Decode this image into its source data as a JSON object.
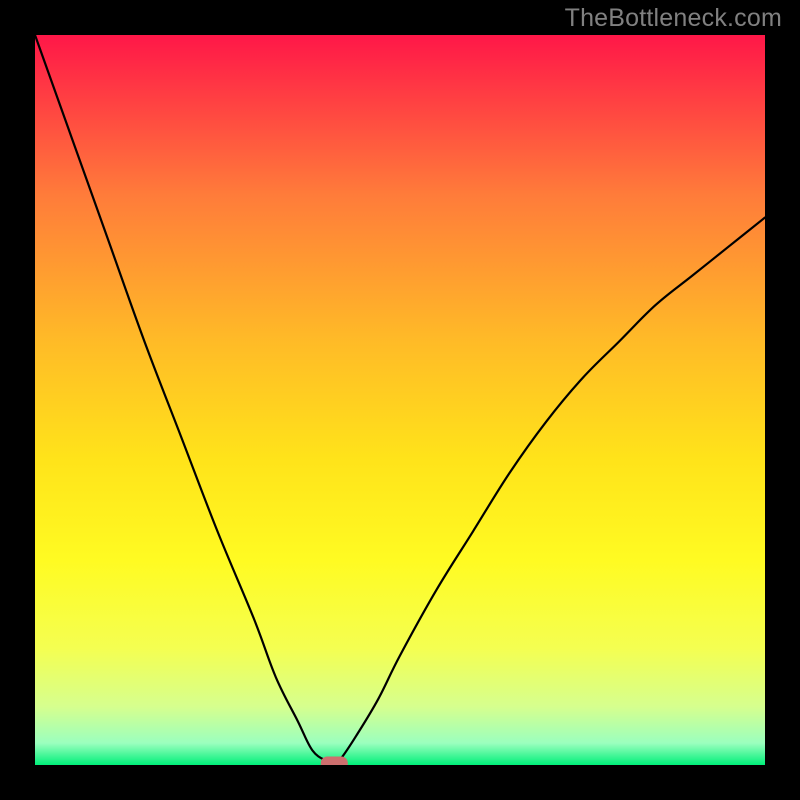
{
  "watermark": "TheBottleneck.com",
  "colors": {
    "frame": "#000000",
    "curve": "#000000",
    "marker_fill": "#cd6f6e",
    "marker_stroke": "#cd6f6e",
    "gradient": {
      "top": "#ff1748",
      "g2": "#ff7c3a",
      "g3": "#ffbb27",
      "g4": "#ffe31a",
      "g5": "#fffb22",
      "g6": "#f4ff51",
      "g7": "#d6ff8e",
      "g8": "#9bffbe",
      "bottom": "#00ef79"
    }
  },
  "chart_data": {
    "type": "line",
    "title": "",
    "xlabel": "",
    "ylabel": "",
    "xlim": [
      0,
      100
    ],
    "ylim": [
      0,
      100
    ],
    "grid": false,
    "legend": false,
    "note": "Bottleneck curve. x is component balance position (arbitrary 0–100), y is bottleneck severity % (0 = balanced, 100 = fully bottlenecked). Values are read off the plotted curve relative to the frame; the chart has no tick labels so units are percent of axis range.",
    "x": [
      0,
      5,
      10,
      15,
      20,
      25,
      30,
      33,
      36,
      38,
      40,
      41,
      42,
      44,
      47,
      50,
      55,
      60,
      65,
      70,
      75,
      80,
      85,
      90,
      95,
      100
    ],
    "y": [
      100,
      86,
      72,
      58,
      45,
      32,
      20,
      12,
      6,
      2,
      0.5,
      0,
      1,
      4,
      9,
      15,
      24,
      32,
      40,
      47,
      53,
      58,
      63,
      67,
      71,
      75
    ],
    "minimum_marker": {
      "x": 41,
      "y": 0,
      "shape": "rounded-rect"
    }
  }
}
